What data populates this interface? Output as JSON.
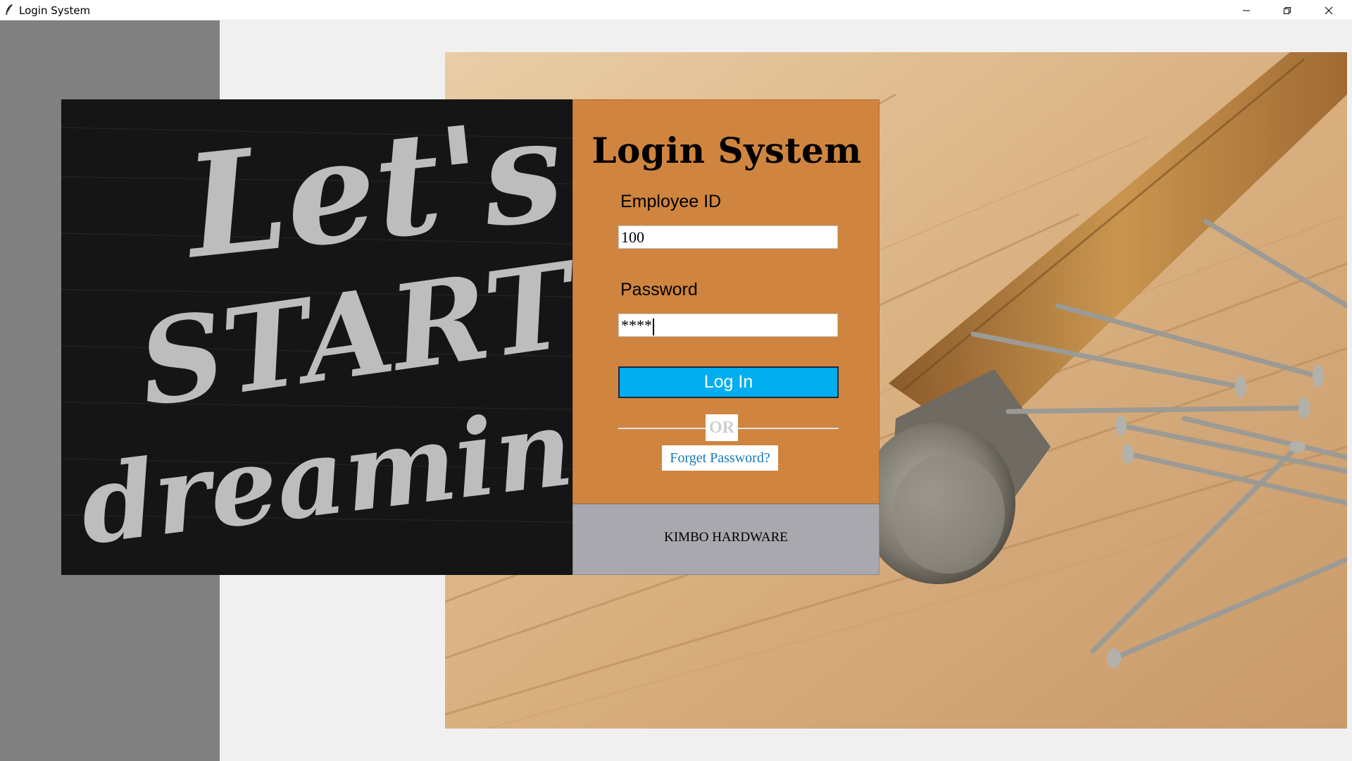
{
  "window": {
    "title": "Login System",
    "controls": [
      "minimize-icon",
      "restore-icon",
      "close-icon"
    ]
  },
  "poster": {
    "text_lines": [
      "Let's",
      "START",
      "dreaming!"
    ]
  },
  "login": {
    "title": "Login System",
    "employee_id_label": "Employee ID",
    "employee_id_value": "100",
    "password_label": "Password",
    "password_value": "****",
    "login_button": "Log In",
    "or_text": "OR",
    "forget_password": "Forget Password?"
  },
  "footer": {
    "company": "KIMBO HARDWARE"
  },
  "colors": {
    "card_bg": "#cf853f",
    "login_button_bg": "#00aef0",
    "footer_bg": "#a9a8ae",
    "side_strip": "#808080",
    "link": "#1478b8"
  }
}
